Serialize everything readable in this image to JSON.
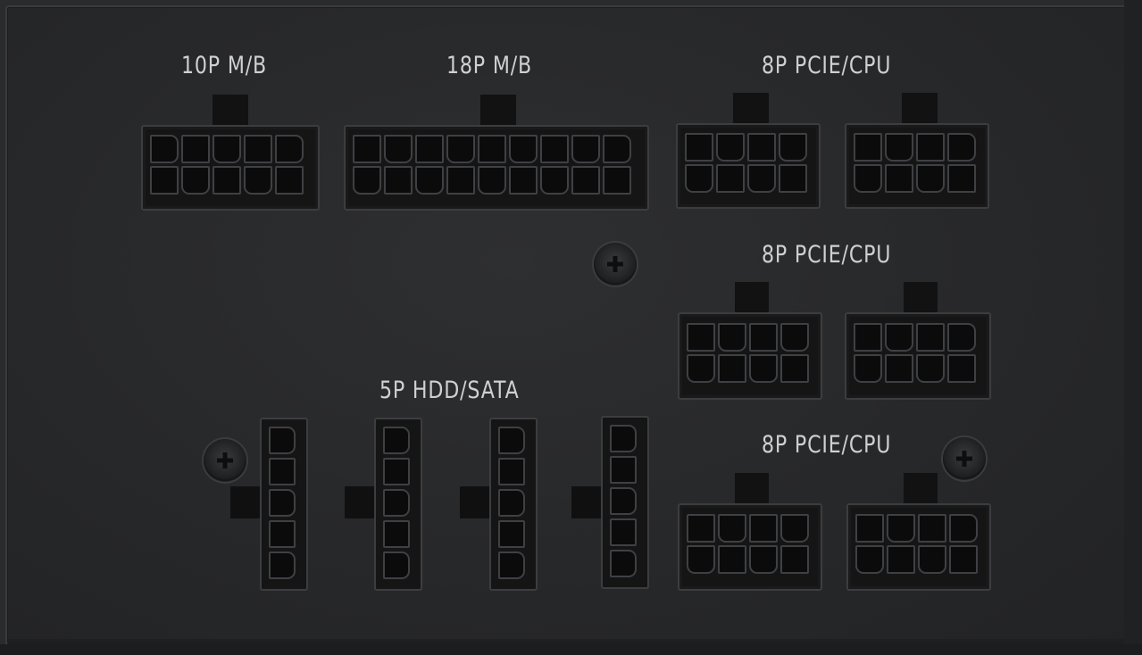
{
  "labels": {
    "mb10": "10P M/B",
    "mb18": "18P M/B",
    "pcie_top": "8P PCIE/CPU",
    "pcie_mid": "8P PCIE/CPU",
    "pcie_bot": "8P PCIE/CPU",
    "hdd": "5P HDD/SATA"
  },
  "colors": {
    "panel": "#2a2b2d",
    "connector": "#151516",
    "label_text": "#cfd0d2"
  },
  "icons": [
    "screw-icon"
  ]
}
